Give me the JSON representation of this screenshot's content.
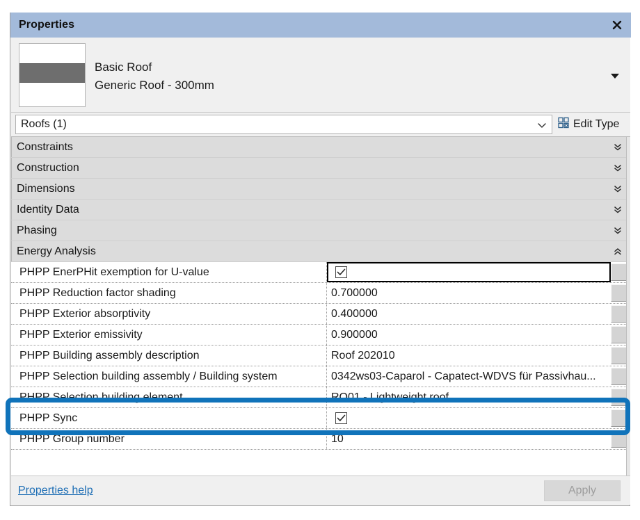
{
  "window": {
    "title": "Properties",
    "close_icon": "close-icon"
  },
  "preview": {
    "family": "Basic Roof",
    "type": "Generic Roof - 300mm",
    "caret_icon": "chevron-down-icon",
    "thumbnail_icon": "roof-section-thumbnail"
  },
  "type_selector": {
    "value": "Roofs (1)",
    "dropdown_icon": "chevron-down-icon",
    "edit_type_label": "Edit Type",
    "edit_type_icon": "edit-type-icon"
  },
  "categories": [
    {
      "label": "Constraints",
      "expanded": false,
      "icon": "double-chevron-down-icon"
    },
    {
      "label": "Construction",
      "expanded": false,
      "icon": "double-chevron-down-icon"
    },
    {
      "label": "Dimensions",
      "expanded": false,
      "icon": "double-chevron-down-icon"
    },
    {
      "label": "Identity Data",
      "expanded": false,
      "icon": "double-chevron-down-icon"
    },
    {
      "label": "Phasing",
      "expanded": false,
      "icon": "double-chevron-down-icon"
    },
    {
      "label": "Energy Analysis",
      "expanded": true,
      "icon": "double-chevron-up-icon"
    }
  ],
  "parameters": [
    {
      "name": "PHPP EnerPHit exemption for U-value",
      "value": "",
      "type": "checkbox",
      "checked": true,
      "focused": true
    },
    {
      "name": "PHPP Reduction factor shading",
      "value": "0.700000",
      "type": "text",
      "focused": false
    },
    {
      "name": "PHPP Exterior absorptivity",
      "value": "0.400000",
      "type": "text",
      "focused": false
    },
    {
      "name": "PHPP Exterior emissivity",
      "value": "0.900000",
      "type": "text",
      "focused": false
    },
    {
      "name": "PHPP Building assembly description",
      "value": "Roof 202010",
      "type": "text",
      "focused": false
    },
    {
      "name": "PHPP Selection building assembly / Building system",
      "value": "0342ws03-Caparol - Capatect-WDVS für Passivhau...",
      "type": "text",
      "focused": false
    },
    {
      "name": "PHPP Selection building element",
      "value": "RO01 - Lightweight roof",
      "type": "text",
      "focused": false
    },
    {
      "name": "PHPP Sync",
      "value": "",
      "type": "checkbox",
      "checked": true,
      "focused": false
    },
    {
      "name": "PHPP Group number",
      "value": "10",
      "type": "text",
      "focused": false
    }
  ],
  "footer": {
    "help_label": "Properties help",
    "apply_label": "Apply",
    "apply_enabled": false
  },
  "annotation": {
    "target": "PHPP Sync",
    "color": "#1073ba"
  },
  "colors": {
    "titlebar": "#a3bada",
    "panel_bg": "#f0f0f0",
    "grid_category_bg": "#dcdcdc",
    "row_bg": "#ffffff",
    "link": "#1f6fb5",
    "highlight": "#1073ba"
  }
}
